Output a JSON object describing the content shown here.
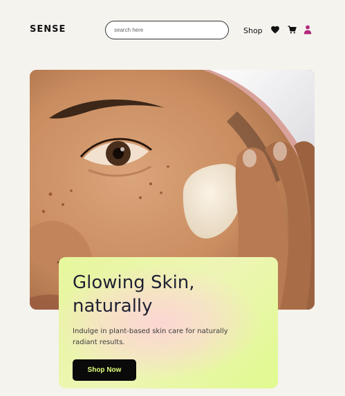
{
  "header": {
    "logo": "SENSE",
    "search_placeholder": "search here",
    "nav_shop_label": "Shop",
    "icons": [
      "heart-icon",
      "cart-icon",
      "user-icon"
    ],
    "user_icon_color": "#b0287a"
  },
  "hero": {
    "image_alt": "hero-photo",
    "title": "Glowing Skin, naturally",
    "description": "Indulge in plant-based skin care for naturally radiant results.",
    "cta_label": "Shop Now",
    "cta_text_color": "#e3ff7c",
    "card_colors": [
      "#e6f79c",
      "#fcd6d3"
    ]
  }
}
